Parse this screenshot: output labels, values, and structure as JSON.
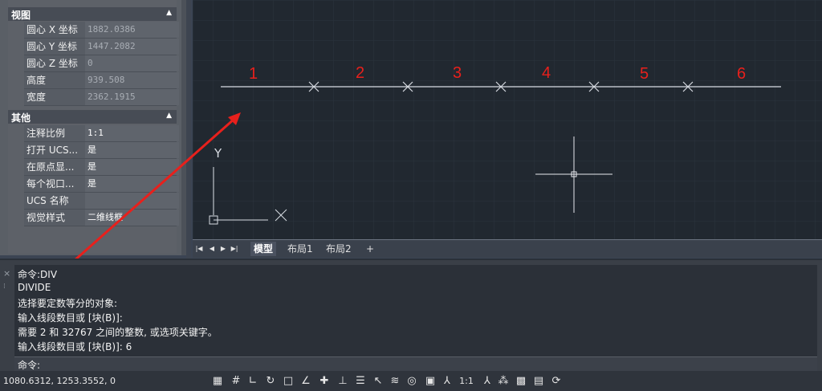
{
  "properties": {
    "sections": [
      {
        "title": "视图",
        "rows": [
          {
            "key": "圆心 X 坐标",
            "value": "1882.0386"
          },
          {
            "key": "圆心 Y 坐标",
            "value": "1447.2082"
          },
          {
            "key": "圆心 Z 坐标",
            "value": "0"
          },
          {
            "key": "高度",
            "value": "939.508"
          },
          {
            "key": "宽度",
            "value": "2362.1915"
          }
        ]
      },
      {
        "title": "其他",
        "rows": [
          {
            "key": "注释比例",
            "value": "1:1"
          },
          {
            "key": "打开 UCS...",
            "value": "是"
          },
          {
            "key": "在原点显...",
            "value": "是"
          },
          {
            "key": "每个视口...",
            "value": "是"
          },
          {
            "key": "UCS 名称",
            "value": ""
          },
          {
            "key": "视觉样式",
            "value": "二维线框"
          }
        ]
      }
    ]
  },
  "drawing": {
    "segment_labels": [
      "1",
      "2",
      "3",
      "4",
      "5",
      "6"
    ],
    "ucs_y_label": "Y",
    "ucs_x_label": "X",
    "annotation_color": "#e8201c",
    "line_color": "#d8dce2"
  },
  "layout_tabs": {
    "tabs": [
      "模型",
      "布局1",
      "布局2"
    ],
    "add_label": "+"
  },
  "command_window": {
    "history": [
      "命令:DIV",
      "DIVIDE",
      "选择要定数等分的对象:",
      "输入线段数目或 [块(B)]:",
      "需要 2 和 32767 之间的整数, 或选项关键字。",
      "输入线段数目或 [块(B)]: 6"
    ],
    "prompt": "命令:"
  },
  "status_bar": {
    "coordinates": "1080.6312, 1253.3552, 0",
    "scale": "1:1"
  }
}
